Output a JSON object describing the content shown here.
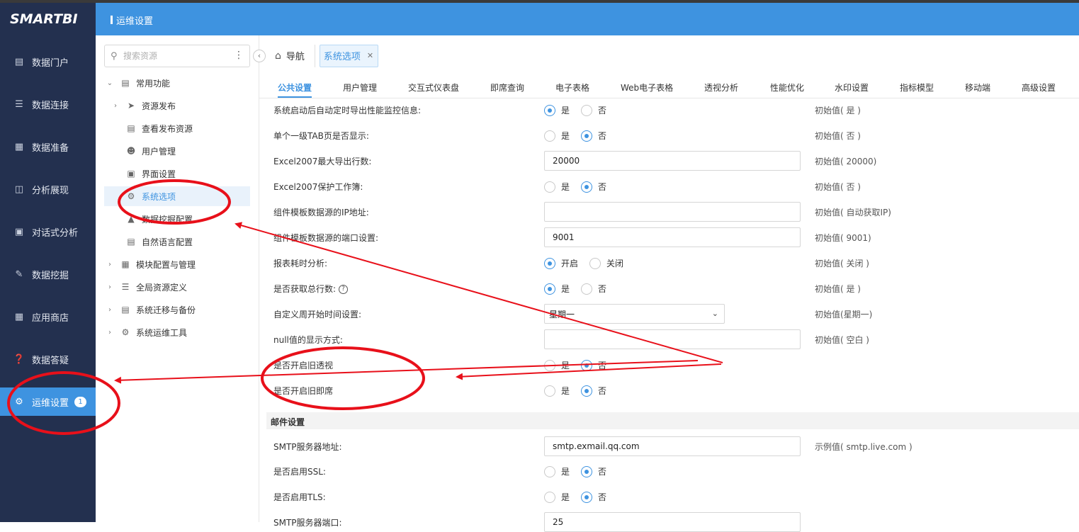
{
  "app": {
    "logo": "SMARTBI",
    "header_title": "运维设置"
  },
  "left_nav": [
    {
      "label": "数据门户",
      "icon": "portal-icon"
    },
    {
      "label": "数据连接",
      "icon": "database-icon"
    },
    {
      "label": "数据准备",
      "icon": "server-icon"
    },
    {
      "label": "分析展现",
      "icon": "bar-chart-icon"
    },
    {
      "label": "对话式分析",
      "icon": "chat-icon"
    },
    {
      "label": "数据挖掘",
      "icon": "pen-icon"
    },
    {
      "label": "应用商店",
      "icon": "grid-icon"
    },
    {
      "label": "数据答疑",
      "icon": "question-icon"
    },
    {
      "label": "运维设置",
      "icon": "gear-icon",
      "badge": "1",
      "active": true
    }
  ],
  "resource_panel": {
    "search_placeholder": "搜索资源",
    "tree": [
      {
        "label": "常用功能",
        "level": 0,
        "arrow": "expanded"
      },
      {
        "label": "资源发布",
        "level": 1,
        "arrow": "collapsed"
      },
      {
        "label": "查看发布资源",
        "level": 1
      },
      {
        "label": "用户管理",
        "level": 1
      },
      {
        "label": "界面设置",
        "level": 1
      },
      {
        "label": "系统选项",
        "level": 1,
        "selected": true
      },
      {
        "label": "数据挖掘配置",
        "level": 1
      },
      {
        "label": "自然语言配置",
        "level": 1
      },
      {
        "label": "模块配置与管理",
        "level": 0,
        "arrow": "collapsed"
      },
      {
        "label": "全局资源定义",
        "level": 0,
        "arrow": "collapsed"
      },
      {
        "label": "系统迁移与备份",
        "level": 0,
        "arrow": "collapsed"
      },
      {
        "label": "系统运维工具",
        "level": 0,
        "arrow": "collapsed"
      }
    ]
  },
  "tabs": {
    "nav_label": "导航",
    "open_tab": "系统选项"
  },
  "subtabs": [
    "公共设置",
    "用户管理",
    "交互式仪表盘",
    "即席查询",
    "电子表格",
    "Web电子表格",
    "透视分析",
    "性能优化",
    "水印设置",
    "指标模型",
    "移动端",
    "高级设置"
  ],
  "settings": [
    {
      "label": "系统启动后自动定时导出性能监控信息:",
      "type": "radio",
      "options": [
        "是",
        "否"
      ],
      "selected": 0,
      "init": "初始值( 是 )"
    },
    {
      "label": "单个一级TAB页是否显示:",
      "type": "radio",
      "options": [
        "是",
        "否"
      ],
      "selected": 1,
      "init": "初始值( 否 )"
    },
    {
      "label": "Excel2007最大导出行数:",
      "type": "input",
      "value": "20000",
      "init": "初始值( 20000)"
    },
    {
      "label": "Excel2007保护工作簿:",
      "type": "radio",
      "options": [
        "是",
        "否"
      ],
      "selected": 1,
      "init": "初始值( 否 )"
    },
    {
      "label": "组件模板数据源的IP地址:",
      "type": "input",
      "value": "",
      "init": "初始值( 自动获取IP)"
    },
    {
      "label": "组件模板数据源的端口设置:",
      "type": "input",
      "value": "9001",
      "init": "初始值( 9001)"
    },
    {
      "label": "报表耗时分析:",
      "type": "radio",
      "options": [
        "开启",
        "关闭"
      ],
      "selected": 0,
      "init": "初始值( 关闭 )"
    },
    {
      "label": "是否获取总行数:",
      "type": "radio",
      "options": [
        "是",
        "否"
      ],
      "selected": 0,
      "init": "初始值( 是 )",
      "help": "?"
    },
    {
      "label": "自定义周开始时间设置:",
      "type": "select",
      "value": "星期一",
      "init": "初始值(星期一)"
    },
    {
      "label": "null值的显示方式:",
      "type": "input",
      "value": "",
      "init": "初始值( 空白 )"
    },
    {
      "label": "是否开启旧透视",
      "type": "radio",
      "options": [
        "是",
        "否"
      ],
      "selected": 1,
      "init": ""
    },
    {
      "label": "是否开启旧即席",
      "type": "radio",
      "options": [
        "是",
        "否"
      ],
      "selected": 1,
      "init": ""
    }
  ],
  "mail_section": {
    "title": "邮件设置",
    "rows": [
      {
        "label": "SMTP服务器地址:",
        "type": "input",
        "value": "smtp.exmail.qq.com",
        "init": "示例值( smtp.live.com )"
      },
      {
        "label": "是否启用SSL:",
        "type": "radio",
        "options": [
          "是",
          "否"
        ],
        "selected": 1,
        "init": ""
      },
      {
        "label": "是否启用TLS:",
        "type": "radio",
        "options": [
          "是",
          "否"
        ],
        "selected": 1,
        "init": ""
      },
      {
        "label": "SMTP服务器端口:",
        "type": "input",
        "value": "25",
        "init": ""
      }
    ]
  },
  "annotation_colors": {
    "markup": "#e8101a",
    "accent": "#3e93e0",
    "nav_bg": "#23304f"
  }
}
